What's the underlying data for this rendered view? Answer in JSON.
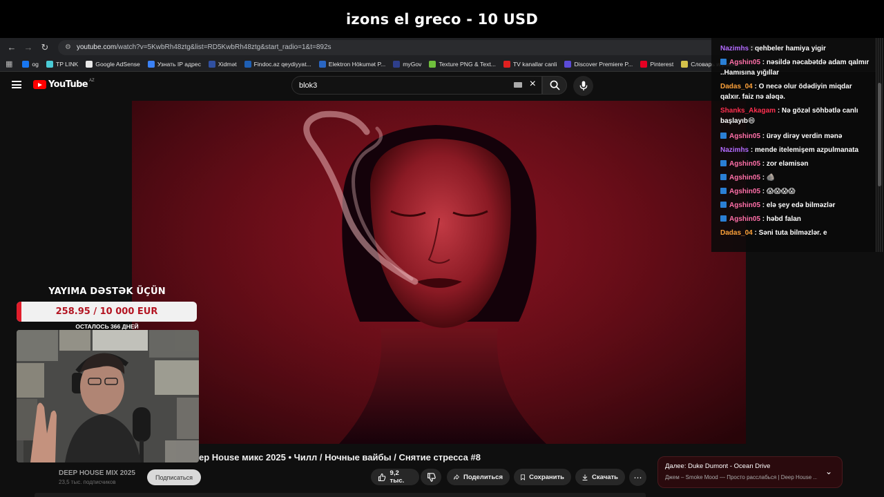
{
  "banner": {
    "text": "izons el greco - 10 USD"
  },
  "browser": {
    "url_domain": "youtube.com",
    "url_rest": "/watch?v=5KwbRh48ztg&list=RD5KwbRh48ztg&start_radio=1&t=892s",
    "bookmarks": [
      {
        "label": "og",
        "color": "#1877f2"
      },
      {
        "label": "TP LINK",
        "color": "#4acbd6"
      },
      {
        "label": "Google AdSense",
        "color": "#e8e8e8"
      },
      {
        "label": "Узнать IP адрес",
        "color": "#3b82f6"
      },
      {
        "label": "Xidmət",
        "color": "#3050a0"
      },
      {
        "label": "Findoc.az qeydiyyat...",
        "color": "#1e5fb4"
      },
      {
        "label": "Elektron Hökumət P...",
        "color": "#2a66c2"
      },
      {
        "label": "myGov",
        "color": "#2e3f8c"
      },
      {
        "label": "Texture PNG & Text...",
        "color": "#6fbf3c"
      },
      {
        "label": "TV kanallar canli",
        "color": "#e02020"
      },
      {
        "label": "Discover Premiere P...",
        "color": "#5b4bd8"
      },
      {
        "label": "Pinterest",
        "color": "#e60023"
      },
      {
        "label": "Словарь игровых т...",
        "color": "#d4c24a"
      }
    ]
  },
  "youtube": {
    "logo_text": "YouTube",
    "region": "AZ",
    "search_value": "blok3"
  },
  "video": {
    "title": "ep House микс 2025 • Чилл / Ночные вайбы / Снятие стресса #8",
    "channel_name": "DEEP HOUSE MIX 2025",
    "channel_subs": "23,5 тыс. подписчиков",
    "subscribe_label": "Подписаться",
    "likes": "9,2 тыс.",
    "share_label": "Поделиться",
    "save_label": "Сохранить",
    "download_label": "Скачать",
    "next_label": "Далее: Duke Dumont - Ocean Drive",
    "next_sub": "Джем – Smoke Mood — Просто расслабься | Deep House ..."
  },
  "chat": {
    "messages": [
      {
        "user": "Nazimhs",
        "text": " : qehbeler hamiya yigir",
        "color": "#b36bff",
        "badge": false
      },
      {
        "user": "Agshin05",
        "text": " : nəsildə nəcabətdə adam qalmır ..Hamısına yığıllar",
        "color": "#ff6fa8",
        "badge": true
      },
      {
        "user": "Dadas_04",
        "text": " : O necə olur ödədiyin miqdar qalxır. faiz nə aləqə.",
        "color": "#ffa23a",
        "badge": false
      },
      {
        "user": "Shanks_Akagam",
        "text": " : Nə gözəl söhbətlə canlı başlayıb😄",
        "color": "#ff2f4f",
        "badge": false
      },
      {
        "user": "Agshin05",
        "text": " : ürəy dirəy verdin mənə",
        "color": "#ff6fa8",
        "badge": true
      },
      {
        "user": "Nazimhs",
        "text": " : mende itelemişem azpulmanata",
        "color": "#b36bff",
        "badge": false
      },
      {
        "user": "Agshin05",
        "text": " : zor eləmisən",
        "color": "#ff6fa8",
        "badge": true
      },
      {
        "user": "Agshin05",
        "text": " : 🪨",
        "color": "#ff6fa8",
        "badge": true
      },
      {
        "user": "Agshin05",
        "text": " : 😱😱😱😱",
        "color": "#ff6fa8",
        "badge": true
      },
      {
        "user": "Agshin05",
        "text": " : elə şey edə bilməzlər",
        "color": "#ff6fa8",
        "badge": true
      },
      {
        "user": "Agshin05",
        "text": " : həbd falan",
        "color": "#ff6fa8",
        "badge": true
      },
      {
        "user": "Dadas_04",
        "text": " : Səni tuta bilməzlər. e",
        "color": "#ffa23a",
        "badge": false
      }
    ]
  },
  "donation": {
    "title": "YAYIMA DƏSTƏK ÜÇÜN",
    "progress_text": "258.95 / 10 000 EUR",
    "progress_fraction": 0.026,
    "days_left": "ОСТАЛОСЬ 366 ДНЕЙ"
  },
  "colors": {
    "accent_red": "#e11d2b",
    "youtube_red": "#ff0000",
    "video_red": "#8a1422"
  }
}
